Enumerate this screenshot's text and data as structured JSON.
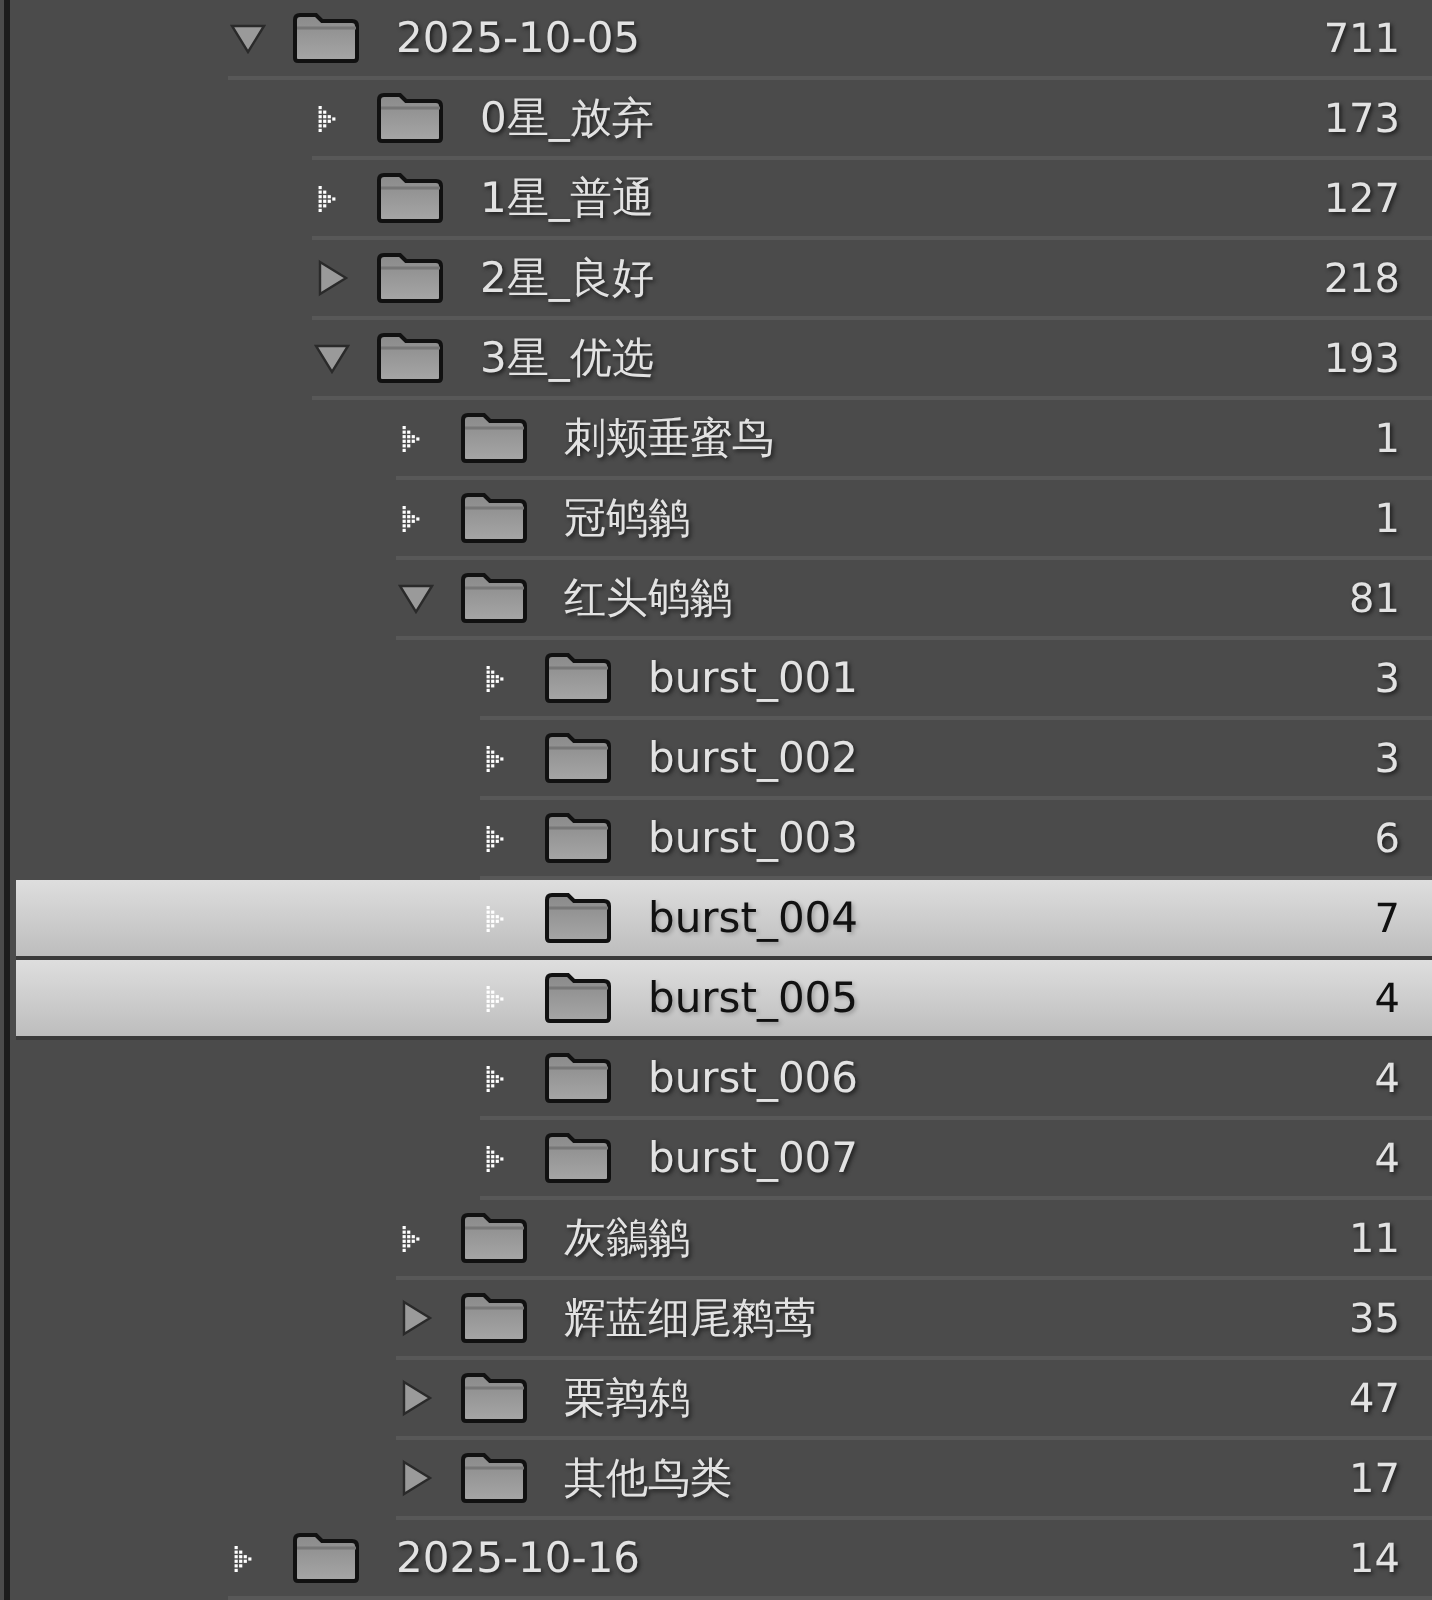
{
  "folders": [
    {
      "name": "2025-10-05",
      "count": "711",
      "kind": "branch",
      "expanded": true,
      "selected": false,
      "children": [
        {
          "name": "0星_放弃",
          "count": "173",
          "kind": "leaf",
          "selected": false
        },
        {
          "name": "1星_普通",
          "count": "127",
          "kind": "leaf",
          "selected": false
        },
        {
          "name": "2星_良好",
          "count": "218",
          "kind": "branch",
          "expanded": false,
          "selected": false
        },
        {
          "name": "3星_优选",
          "count": "193",
          "kind": "branch",
          "expanded": true,
          "selected": false,
          "children": [
            {
              "name": "刺颊垂蜜鸟",
              "count": "1",
              "kind": "leaf",
              "selected": false
            },
            {
              "name": "冠鸲鹟",
              "count": "1",
              "kind": "leaf",
              "selected": false
            },
            {
              "name": "红头鸲鹟",
              "count": "81",
              "kind": "branch",
              "expanded": true,
              "selected": false,
              "children": [
                {
                  "name": "burst_001",
                  "count": "3",
                  "kind": "leaf",
                  "selected": false
                },
                {
                  "name": "burst_002",
                  "count": "3",
                  "kind": "leaf",
                  "selected": false
                },
                {
                  "name": "burst_003",
                  "count": "6",
                  "kind": "leaf",
                  "selected": false
                },
                {
                  "name": "burst_004",
                  "count": "7",
                  "kind": "leaf",
                  "selected": true
                },
                {
                  "name": "burst_005",
                  "count": "4",
                  "kind": "leaf",
                  "selected": true
                },
                {
                  "name": "burst_006",
                  "count": "4",
                  "kind": "leaf",
                  "selected": false
                },
                {
                  "name": "burst_007",
                  "count": "4",
                  "kind": "leaf",
                  "selected": false
                }
              ]
            },
            {
              "name": "灰鶲鹟",
              "count": "11",
              "kind": "leaf",
              "selected": false
            },
            {
              "name": "辉蓝细尾鹩莺",
              "count": "35",
              "kind": "branch",
              "expanded": false,
              "selected": false
            },
            {
              "name": "栗鹑鸫",
              "count": "47",
              "kind": "branch",
              "expanded": false,
              "selected": false
            },
            {
              "name": "其他鸟类",
              "count": "17",
              "kind": "branch",
              "expanded": false,
              "selected": false
            }
          ]
        }
      ]
    },
    {
      "name": "2025-10-16",
      "count": "14",
      "kind": "leaf",
      "selected": false
    }
  ]
}
